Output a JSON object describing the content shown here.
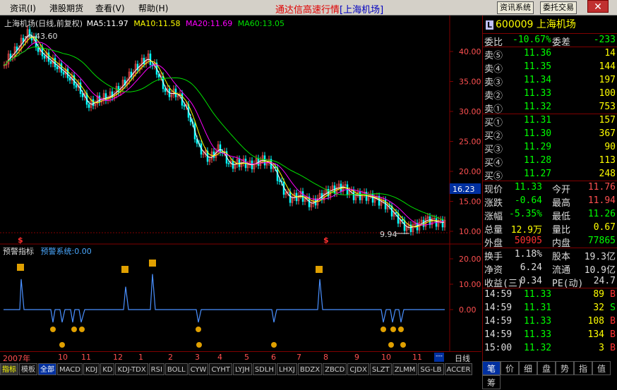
{
  "menu": {
    "items": [
      "资讯(I)",
      "港股期货",
      "查看(V)",
      "帮助(H)"
    ],
    "title": "通达信高速行情",
    "title_suffix": "[上海机场]",
    "btn_info": "资讯系统",
    "btn_trade": "委托交易"
  },
  "main_chart": {
    "header": "上海机场(日线,前复权)",
    "ma5": "MA5:11.97",
    "ma10": "MA10:11.58",
    "ma20": "MA20:11.69",
    "ma60": "MA60:13.05",
    "high_label": "43.60",
    "low_label": "9.94",
    "price_badge": "16.23",
    "y_ticks": [
      "40.00",
      "35.00",
      "30.00",
      "25.00",
      "20.00",
      "15.00",
      "10.00"
    ]
  },
  "sub_chart": {
    "header": "预警指标",
    "value_label": "预警系统:0.00",
    "y_ticks": [
      "20.00",
      "10.00",
      "0.00"
    ]
  },
  "time_axis": {
    "year": "2007年",
    "months": [
      "10",
      "11",
      "12",
      "1",
      "2",
      "3",
      "4",
      "5",
      "6",
      "7",
      "8",
      "9",
      "10",
      "11"
    ],
    "period": "日线"
  },
  "tabs": [
    "指标",
    "模板",
    "全部",
    "MACD",
    "KDJ",
    "KD",
    "KDJ-TDX",
    "RSI",
    "BOLL",
    "CYW",
    "CYHT",
    "LYJH",
    "SDLH",
    "LHXJ",
    "BDZX",
    "ZBCD",
    "CJDX",
    "SLZT",
    "ZLMM",
    "SG-LB",
    "ACCER"
  ],
  "quote": {
    "code": "600009",
    "name": "上海机场",
    "weibi_label": "委比",
    "weibi": "-10.67%",
    "weicha_label": "委差",
    "weicha": "-233",
    "sell": [
      {
        "label": "卖⑤",
        "price": "11.36",
        "vol": "14"
      },
      {
        "label": "卖④",
        "price": "11.35",
        "vol": "144"
      },
      {
        "label": "卖③",
        "price": "11.34",
        "vol": "197"
      },
      {
        "label": "卖②",
        "price": "11.33",
        "vol": "100"
      },
      {
        "label": "卖①",
        "price": "11.32",
        "vol": "753"
      }
    ],
    "buy": [
      {
        "label": "买①",
        "price": "11.31",
        "vol": "157"
      },
      {
        "label": "买②",
        "price": "11.30",
        "vol": "367"
      },
      {
        "label": "买③",
        "price": "11.29",
        "vol": "90"
      },
      {
        "label": "买④",
        "price": "11.28",
        "vol": "113"
      },
      {
        "label": "买⑤",
        "price": "11.27",
        "vol": "248"
      }
    ],
    "stats1": [
      {
        "l1": "现价",
        "v1": "11.33",
        "l2": "今开",
        "v2": "11.76"
      },
      {
        "l1": "涨跌",
        "v1": "-0.64",
        "l2": "最高",
        "v2": "11.94"
      },
      {
        "l1": "涨幅",
        "v1": "-5.35%",
        "l2": "最低",
        "v2": "11.26"
      },
      {
        "l1": "总量",
        "v1": "12.9万",
        "l2": "量比",
        "v2": "0.67"
      },
      {
        "l1": "外盘",
        "v1": "50905",
        "l2": "内盘",
        "v2": "77865"
      }
    ],
    "stats2": [
      {
        "l1": "换手",
        "v1": "1.18%",
        "l2": "股本",
        "v2": "19.3亿"
      },
      {
        "l1": "净资",
        "v1": "6.24",
        "l2": "流通",
        "v2": "10.9亿"
      },
      {
        "l1": "收益(三)",
        "v1": "0.34",
        "l2": "PE(动)",
        "v2": "24.7"
      }
    ],
    "ticks": [
      {
        "time": "14:59",
        "price": "11.33",
        "vol": "89",
        "bs": "B"
      },
      {
        "time": "14:59",
        "price": "11.31",
        "vol": "32",
        "bs": "S"
      },
      {
        "time": "14:59",
        "price": "11.33",
        "vol": "108",
        "bs": "B"
      },
      {
        "time": "14:59",
        "price": "11.33",
        "vol": "134",
        "bs": "B"
      },
      {
        "time": "15:00",
        "price": "11.32",
        "vol": "3",
        "bs": "B"
      }
    ],
    "bottom_tabs": [
      "笔",
      "价",
      "细",
      "盘",
      "势",
      "指",
      "值",
      "筹"
    ]
  },
  "colors": {
    "up": "#ff5050",
    "down": "#00ffff",
    "ma5": "#ffffff",
    "ma10": "#ffff00",
    "ma20": "#ff00ff",
    "ma60": "#00e000"
  }
}
